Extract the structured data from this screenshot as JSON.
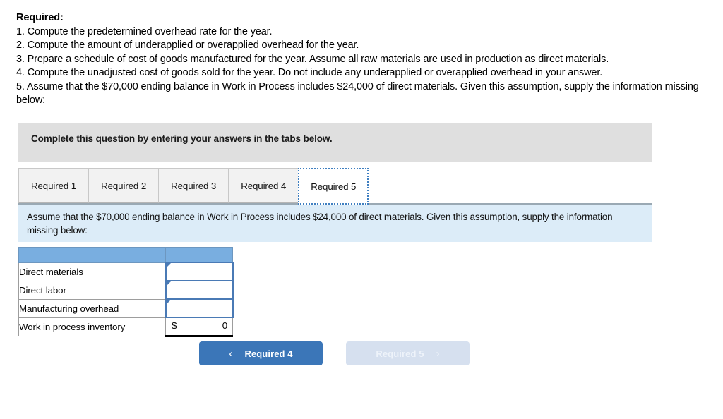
{
  "requirements": {
    "title": "Required:",
    "items": [
      "1. Compute the predetermined overhead rate for the year.",
      "2. Compute the amount of underapplied or overapplied overhead for the year.",
      "3. Prepare a schedule of cost of goods manufactured for the year. Assume all raw materials are used in production as direct materials.",
      "4. Compute the unadjusted cost of goods sold for the year. Do not include any underapplied or overapplied overhead in your answer.",
      "5. Assume that the $70,000 ending balance in Work in Process includes $24,000 of direct materials. Given this assumption, supply the information missing below:"
    ]
  },
  "banner": {
    "text": "Complete this question by entering your answers in the tabs below."
  },
  "tabs": [
    {
      "label": "Required 1",
      "active": false
    },
    {
      "label": "Required 2",
      "active": false
    },
    {
      "label": "Required 3",
      "active": false
    },
    {
      "label": "Required 4",
      "active": false
    },
    {
      "label": "Required 5",
      "active": true
    }
  ],
  "note": {
    "text": "Assume that the $70,000 ending balance in Work in Process includes $24,000 of direct materials. Given this assumption, supply the information missing below:"
  },
  "table": {
    "header": {
      "label": "",
      "value": ""
    },
    "rows": [
      {
        "label": "Direct materials",
        "value": "",
        "type": "input"
      },
      {
        "label": "Direct labor",
        "value": "",
        "type": "input"
      },
      {
        "label": "Manufacturing overhead",
        "value": "",
        "type": "input"
      },
      {
        "label": "Work in process inventory",
        "currency": "$",
        "value": "0",
        "type": "total"
      }
    ]
  },
  "nav": {
    "prev_label": "Required 4",
    "prev_icon": "chevron-left-icon",
    "prev_chevron": "‹",
    "next_label": "Required 5",
    "next_icon": "chevron-right-icon",
    "next_chevron": "›"
  },
  "colors": {
    "accent_blue": "#3b76b8",
    "disabled_blue": "#d6e0ef",
    "note_panel": "#dcecf8",
    "banner_grey": "#dfdfdf",
    "table_header_blue": "#79aee0",
    "input_border": "#4a7ab5"
  }
}
